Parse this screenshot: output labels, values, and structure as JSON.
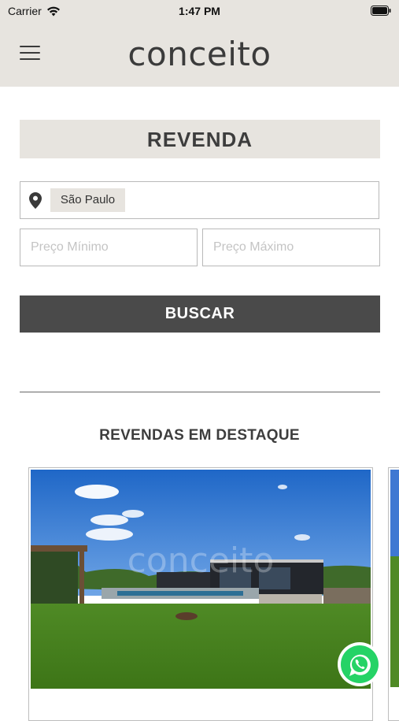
{
  "status_bar": {
    "carrier": "Carrier",
    "time": "1:47 PM"
  },
  "header": {
    "logo_text": "conceito",
    "menu_icon": "hamburger-menu-icon"
  },
  "search": {
    "title": "REVENDA",
    "location_chip": "São Paulo",
    "price_min_placeholder": "Preço Mínimo",
    "price_max_placeholder": "Preço Máximo",
    "button_label": "BUSCAR"
  },
  "featured": {
    "title": "REVENDAS EM DESTAQUE",
    "watermark": "conceito"
  },
  "colors": {
    "header_bg": "#e7e4df",
    "button_bg": "#4a4a4a",
    "logo_dot": "#e35b1e",
    "whatsapp": "#25d366"
  }
}
